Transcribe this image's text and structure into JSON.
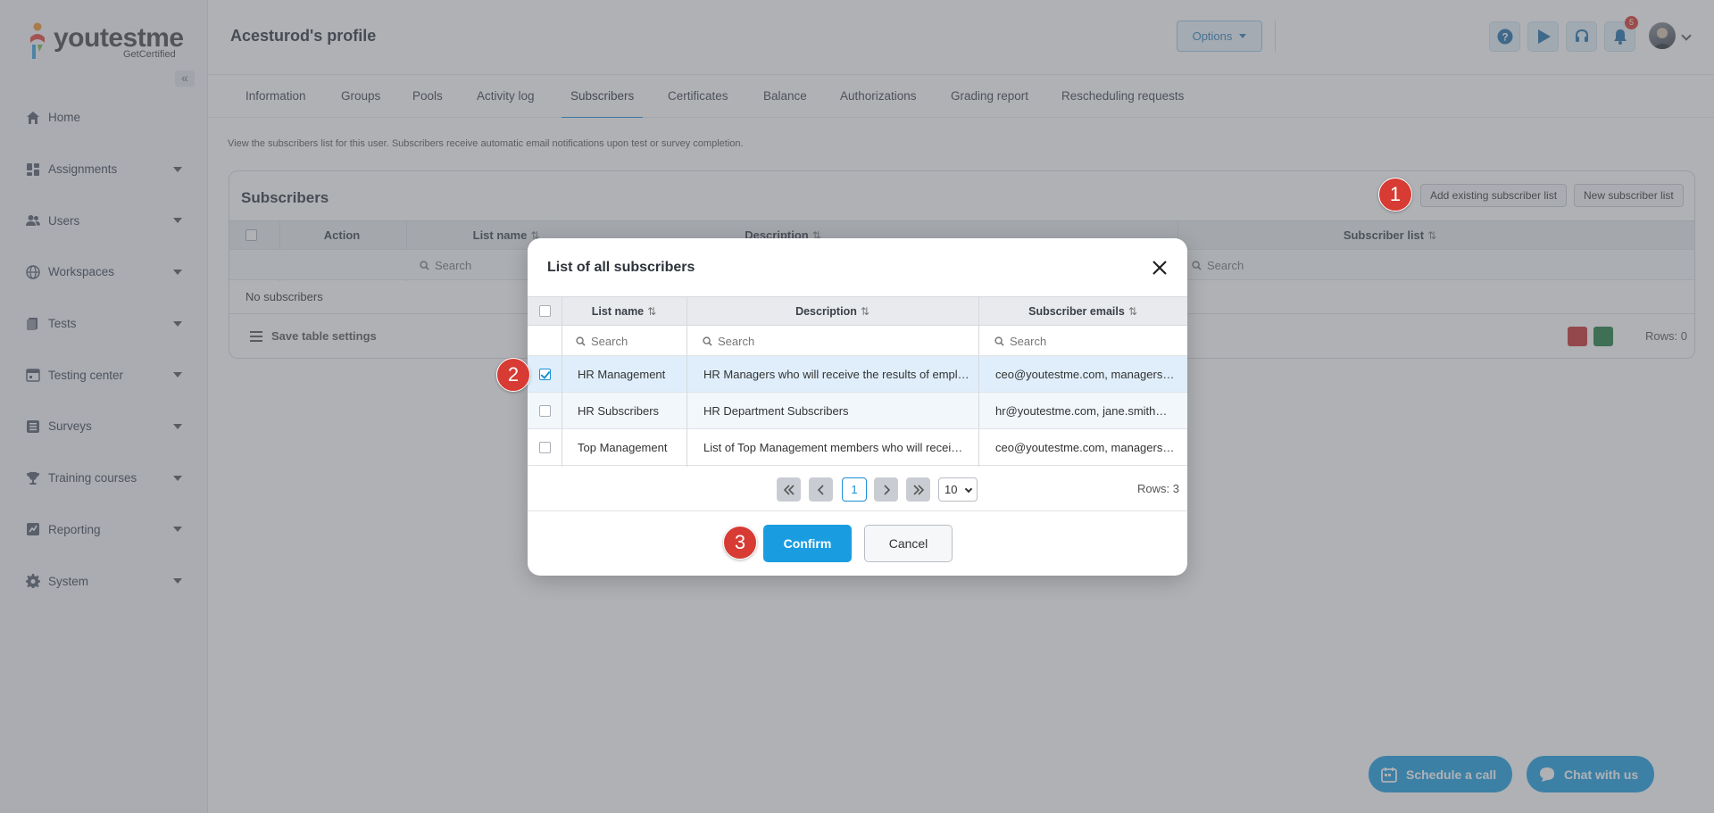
{
  "app": {
    "logo_text": "youtestme",
    "logo_sub": "GetCertified"
  },
  "sidebar": {
    "items": [
      {
        "label": "Home",
        "icon": "home-icon",
        "has_caret": false
      },
      {
        "label": "Assignments",
        "icon": "dashboard-icon",
        "has_caret": true
      },
      {
        "label": "Users",
        "icon": "users-icon",
        "has_caret": true
      },
      {
        "label": "Workspaces",
        "icon": "globe-icon",
        "has_caret": true
      },
      {
        "label": "Tests",
        "icon": "tests-icon",
        "has_caret": true
      },
      {
        "label": "Testing center",
        "icon": "calendar-icon",
        "has_caret": true
      },
      {
        "label": "Surveys",
        "icon": "list-icon",
        "has_caret": true
      },
      {
        "label": "Training courses",
        "icon": "trophy-icon",
        "has_caret": true
      },
      {
        "label": "Reporting",
        "icon": "chart-icon",
        "has_caret": true
      },
      {
        "label": "System",
        "icon": "gear-icon",
        "has_caret": true
      }
    ]
  },
  "header": {
    "title": "Acesturod's profile",
    "options_label": "Options",
    "notification_count": "5"
  },
  "tabs": [
    {
      "label": "Information"
    },
    {
      "label": "Groups"
    },
    {
      "label": "Pools"
    },
    {
      "label": "Activity log"
    },
    {
      "label": "Subscribers",
      "active": true
    },
    {
      "label": "Certificates"
    },
    {
      "label": "Balance"
    },
    {
      "label": "Authorizations"
    },
    {
      "label": "Grading report"
    },
    {
      "label": "Rescheduling requests"
    }
  ],
  "main": {
    "info_text": "View the subscribers list for this user. Subscribers receive automatic email notifications upon test or survey completion.",
    "panel": {
      "title": "Subscribers",
      "add_existing_label": "Add existing subscriber list",
      "new_list_label": "New subscriber list",
      "columns": [
        "Action",
        "List name",
        "Description",
        "Subscriber list"
      ],
      "search_placeholder": "Search",
      "empty_text": "No subscribers",
      "save_settings_label": "Save table settings",
      "rows_label": "Rows: 0"
    }
  },
  "modal": {
    "title": "List of all subscribers",
    "columns": [
      "List name",
      "Description",
      "Subscriber emails"
    ],
    "search_placeholder": "Search",
    "rows": [
      {
        "name": "HR Management",
        "description": "HR Managers who will receive the results of empl…",
        "emails": "ceo@youtestme.com, managers…",
        "checked": true
      },
      {
        "name": "HR Subscribers",
        "description": "HR Department Subscribers",
        "emails": "hr@youtestme.com, jane.smith…",
        "checked": false
      },
      {
        "name": "Top Management",
        "description": "List of Top Management members who will recei…",
        "emails": "ceo@youtestme.com, managers…",
        "checked": false
      }
    ],
    "current_page": "1",
    "page_size": "10",
    "rows_label": "Rows: 3",
    "confirm_label": "Confirm",
    "cancel_label": "Cancel"
  },
  "steps": [
    "1",
    "2",
    "3"
  ],
  "fab": {
    "schedule_label": "Schedule a call",
    "chat_label": "Chat with us"
  },
  "colors": {
    "accent": "#1a9de0",
    "step_marker": "#d73b33",
    "selected_row": "#dfeefa"
  }
}
